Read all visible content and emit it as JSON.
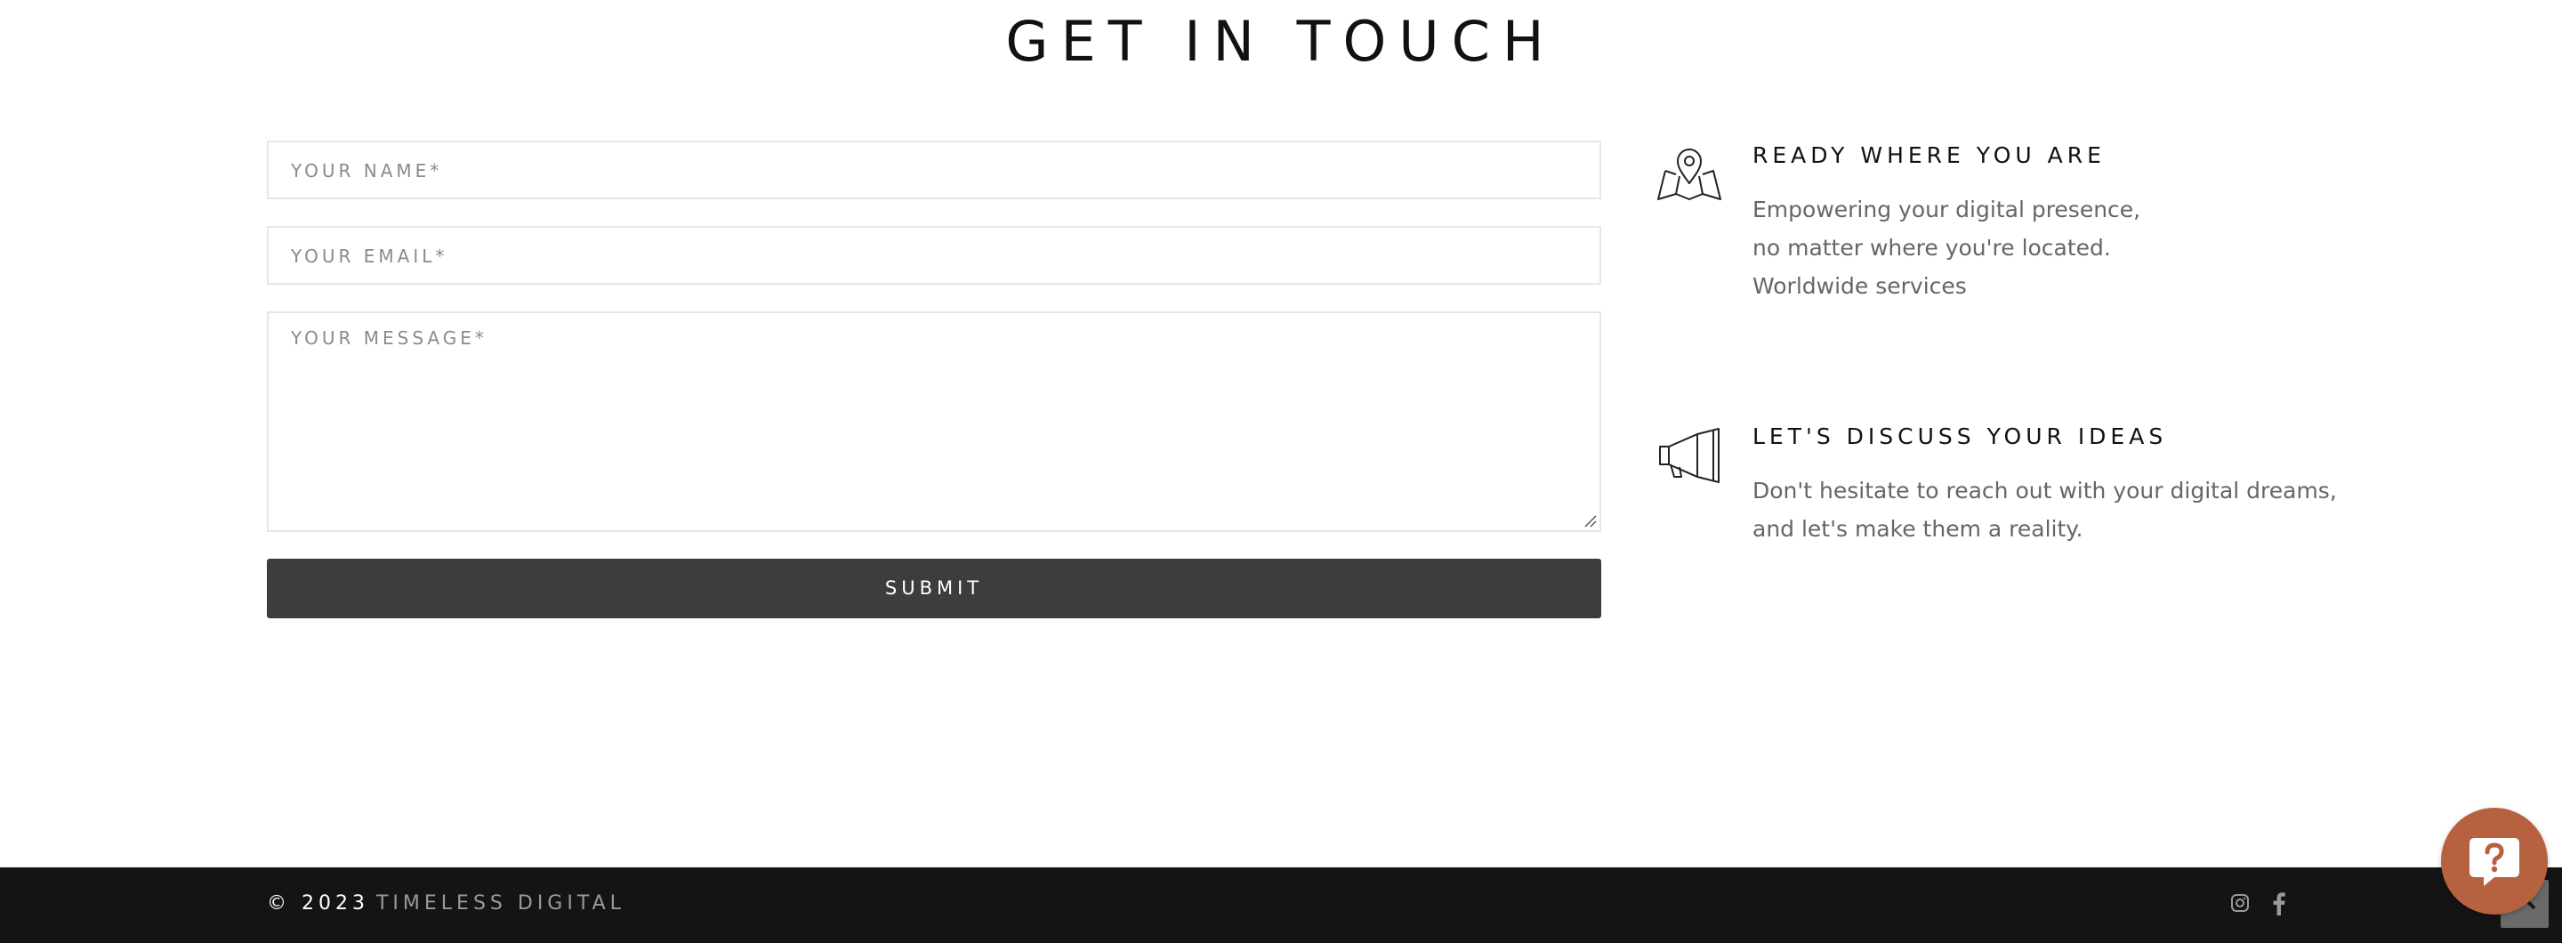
{
  "heading": "GET IN TOUCH",
  "form": {
    "name_placeholder": "YOUR NAME*",
    "email_placeholder": "YOUR EMAIL*",
    "message_placeholder": "YOUR MESSAGE*",
    "submit_label": "SUBMIT"
  },
  "info": [
    {
      "icon": "map-pin-icon",
      "title": "READY WHERE YOU ARE",
      "lines": [
        "Empowering your digital presence,",
        "no matter where you're located.",
        "Worldwide services"
      ]
    },
    {
      "icon": "megaphone-icon",
      "title": "LET'S DISCUSS YOUR IDEAS",
      "lines": [
        "Don't hesitate to reach out with your digital dreams,",
        "and let's make them a reality."
      ]
    }
  ],
  "footer": {
    "copyright_year": "© 2023",
    "brand": "TIMELESS DIGITAL",
    "social": [
      "instagram-icon",
      "facebook-icon"
    ]
  },
  "colors": {
    "button": "#3d3d3d",
    "footer": "#141414",
    "help_button": "#b6613f"
  }
}
